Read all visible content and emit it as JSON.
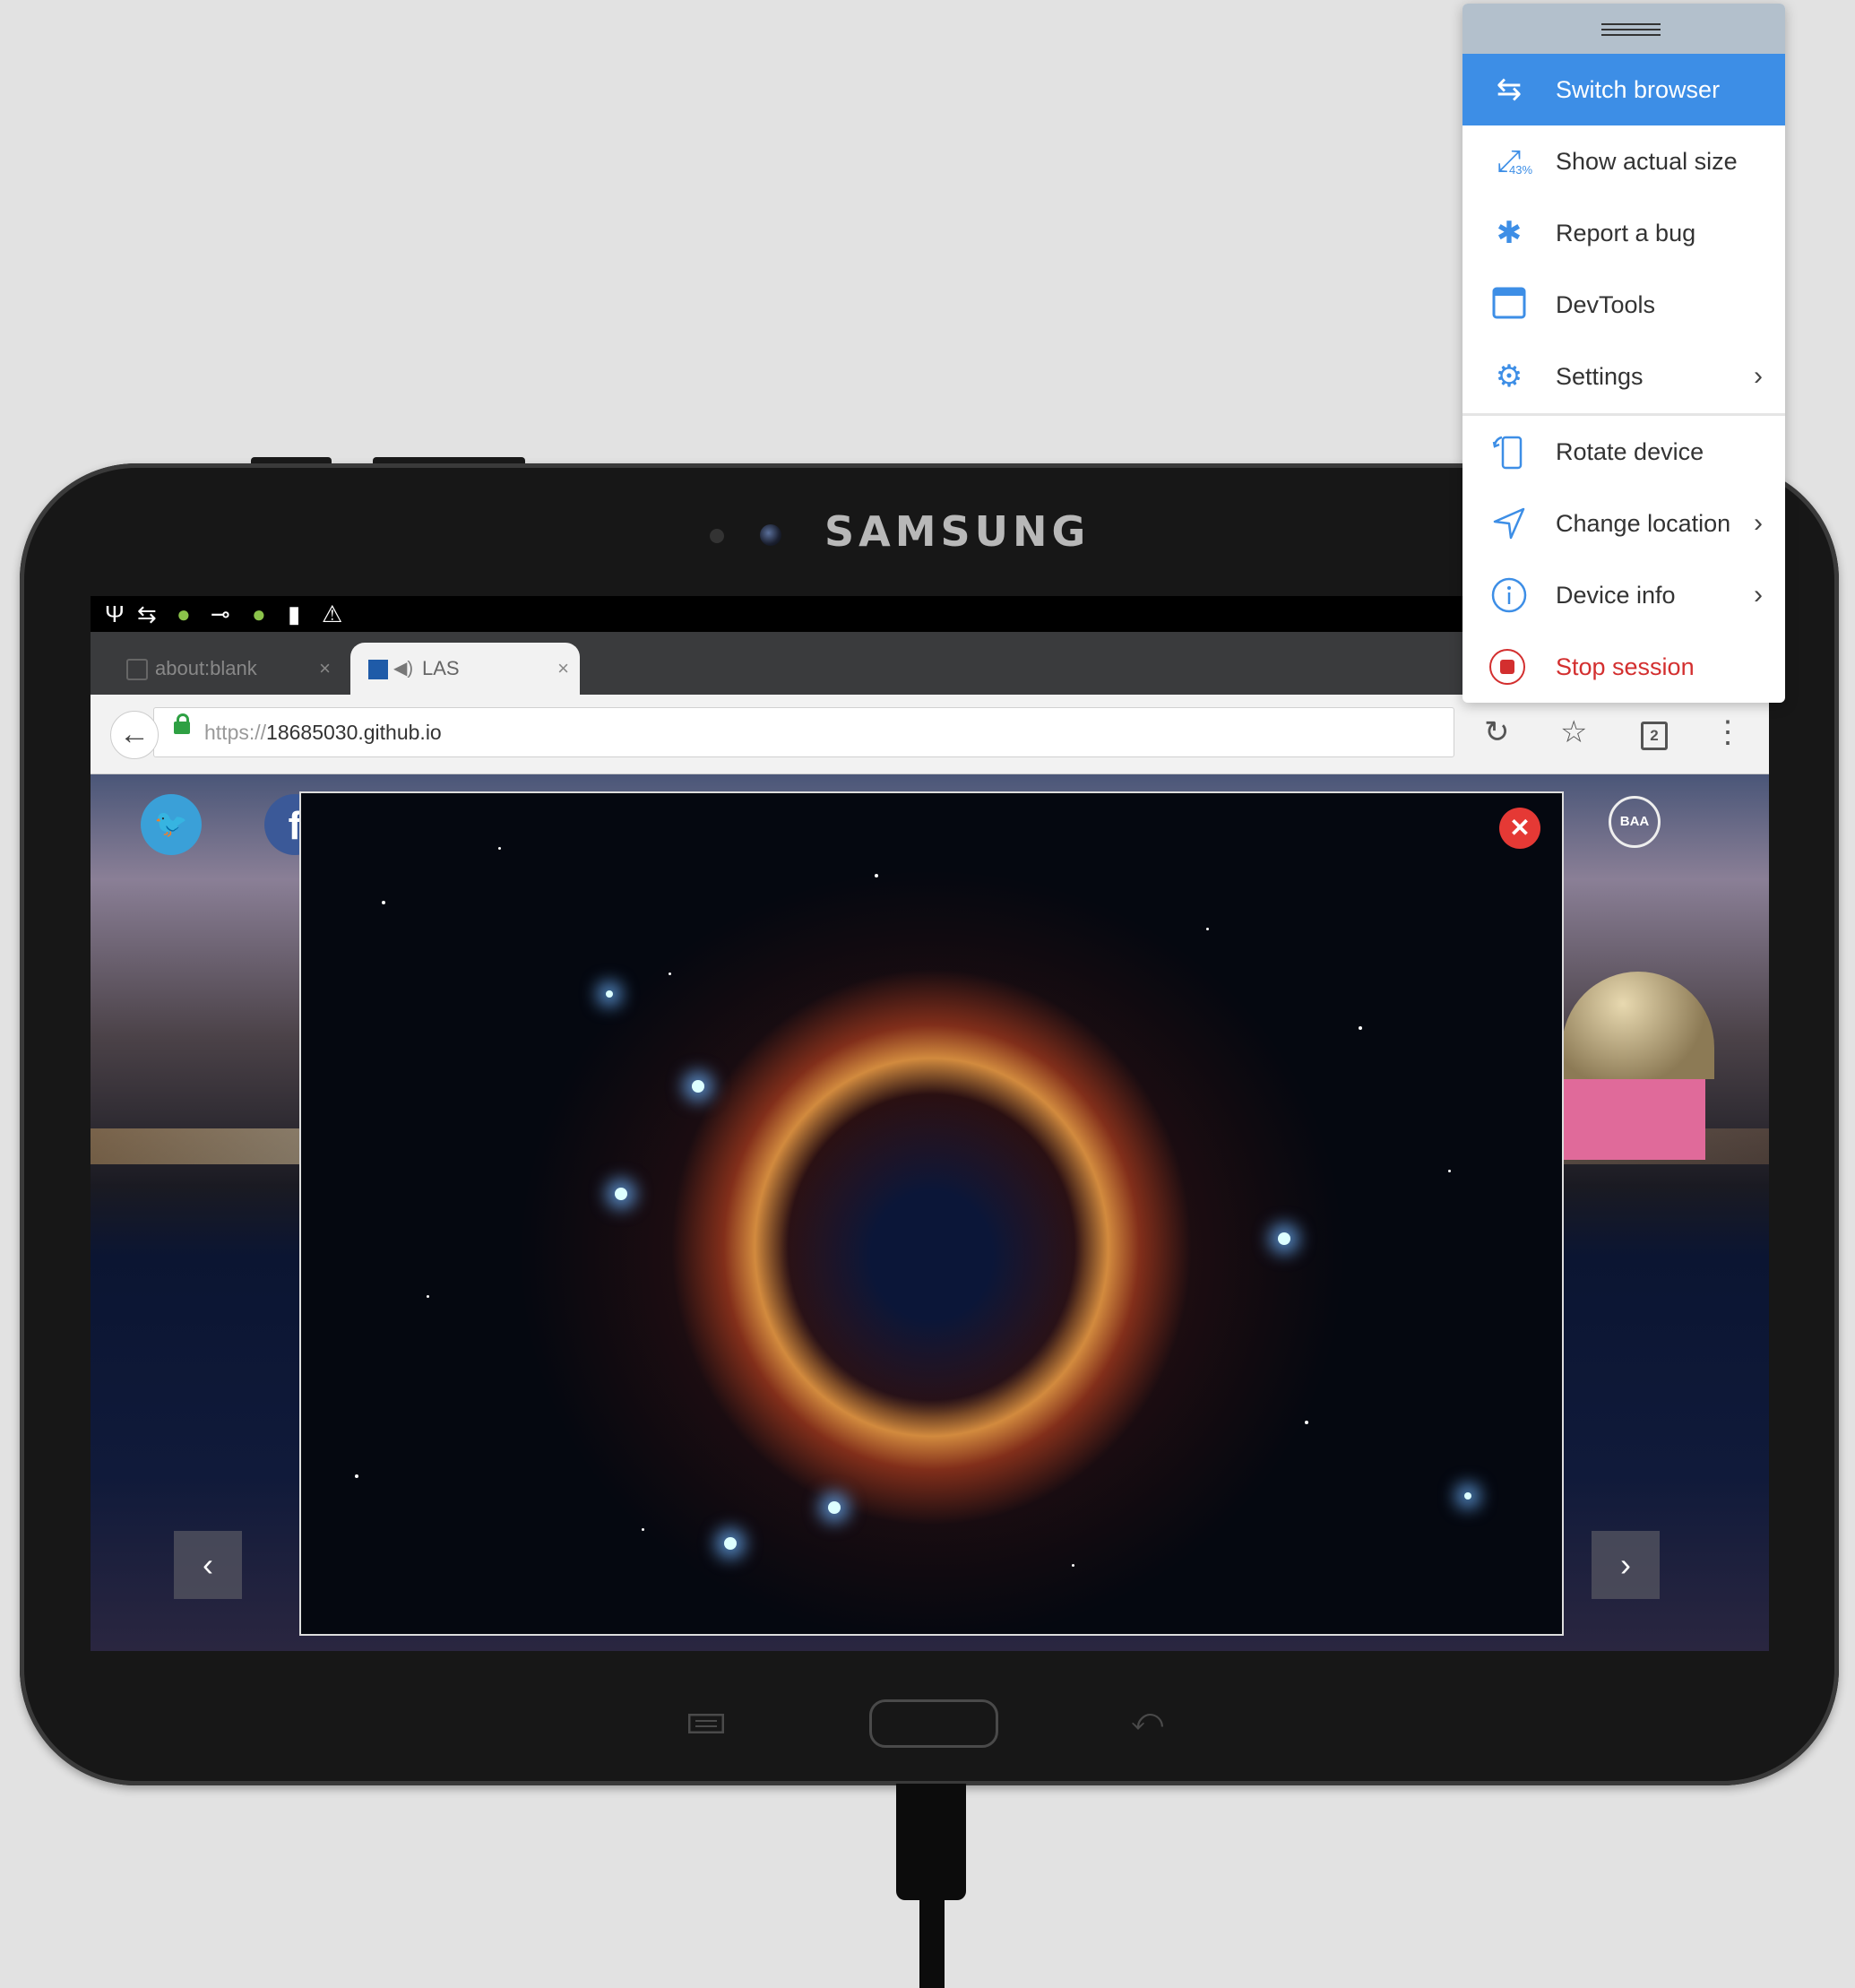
{
  "tablet": {
    "brand": "SAMSUNG"
  },
  "browser": {
    "tabs": [
      {
        "title": "about:blank",
        "close": "×"
      },
      {
        "title": "LAS",
        "close": "×"
      }
    ],
    "url_scheme": "https://",
    "url_host": "18685030.github.io",
    "open_tab_count": "2"
  },
  "page": {
    "badge": "BAA",
    "prev": "‹",
    "next": "›",
    "popup_close": "✕"
  },
  "menu": {
    "items": [
      {
        "label": "Switch browser",
        "icon": "switch-arrows-icon",
        "active": true
      },
      {
        "label": "Show actual size",
        "icon": "resize-arrows-icon",
        "badge": "43%"
      },
      {
        "label": "Report a bug",
        "icon": "bug-icon"
      },
      {
        "label": "DevTools",
        "icon": "window-icon"
      },
      {
        "label": "Settings",
        "icon": "gear-icon",
        "submenu": true
      },
      {
        "label": "Rotate device",
        "icon": "rotate-device-icon"
      },
      {
        "label": "Change location",
        "icon": "location-arrow-icon",
        "submenu": true
      },
      {
        "label": "Device info",
        "icon": "info-icon",
        "submenu": true
      },
      {
        "label": "Stop session",
        "icon": "stop-icon",
        "danger": true
      }
    ]
  },
  "colors": {
    "accent": "#3d8ee6",
    "danger": "#d32f2f",
    "menu_handle": "#b3c0cc"
  }
}
